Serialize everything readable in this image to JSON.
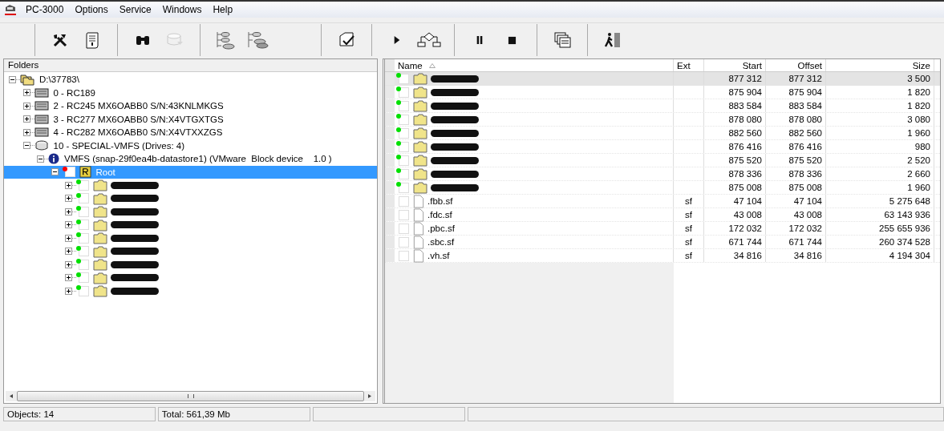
{
  "menu": [
    {
      "label": "PC-3000"
    },
    {
      "label": "Options"
    },
    {
      "label": "Service"
    },
    {
      "label": "Windows"
    },
    {
      "label": "Help"
    }
  ],
  "toolbar": [
    [
      {
        "kind": "tools",
        "disabled": false
      },
      {
        "kind": "scroll",
        "disabled": false
      }
    ],
    [
      {
        "kind": "binoculars",
        "disabled": false
      },
      {
        "kind": "disk",
        "disabled": true
      }
    ],
    [
      {
        "kind": "tree",
        "disabled": false
      },
      {
        "kind": "disks",
        "disabled": false
      }
    ],
    [
      {
        "kind": "document",
        "disabled": false
      }
    ],
    [
      {
        "kind": "play",
        "disabled": false
      },
      {
        "kind": "flowchart",
        "disabled": false
      }
    ],
    [
      {
        "kind": "pause",
        "disabled": false
      },
      {
        "kind": "stop",
        "disabled": false
      }
    ],
    [
      {
        "kind": "windows",
        "disabled": false
      }
    ],
    [
      {
        "kind": "exit",
        "disabled": false
      }
    ]
  ],
  "folders": {
    "title": "Folders",
    "tree": [
      {
        "label": "D:\\37783\\",
        "kind": "project",
        "expanded": true,
        "selected": false,
        "children": [
          {
            "label": "0 - RC189",
            "kind": "drive",
            "expanded": false,
            "selected": false
          },
          {
            "label": "2 - RC245 MX6OABB0 S/N:43KNLMKGS",
            "kind": "drive",
            "expanded": false,
            "selected": false
          },
          {
            "label": "3 - RC277 MX6OABB0 S/N:X4VTGXTGS",
            "kind": "drive",
            "expanded": false,
            "selected": false
          },
          {
            "label": "4 - RC282 MX6OABB0 S/N:X4VTXXZGS",
            "kind": "drive",
            "expanded": false,
            "selected": false
          },
          {
            "label": "10 - SPECIAL-VMFS (Drives: 4)",
            "kind": "array",
            "expanded": true,
            "selected": false,
            "children": [
              {
                "label": "VMFS (snap-29f0ea4b-datastore1) (VMware  Block device    1.0 )",
                "kind": "volume",
                "expanded": true,
                "selected": false,
                "children": [
                  {
                    "label": "Root",
                    "kind": "root",
                    "expanded": true,
                    "selected": true,
                    "checked": false,
                    "color": "#ff0000",
                    "children": [
                      {
                        "kind": "folder",
                        "expanded": false,
                        "selected": false,
                        "checked": false,
                        "color": "#00e000"
                      },
                      {
                        "kind": "folder",
                        "expanded": false,
                        "selected": false,
                        "checked": false,
                        "color": "#00e000"
                      },
                      {
                        "kind": "folder",
                        "expanded": false,
                        "selected": false,
                        "checked": false,
                        "color": "#00e000"
                      },
                      {
                        "kind": "folder",
                        "expanded": false,
                        "selected": false,
                        "checked": false,
                        "color": "#00e000"
                      },
                      {
                        "kind": "folder",
                        "expanded": false,
                        "selected": false,
                        "checked": false,
                        "color": "#00e000"
                      },
                      {
                        "kind": "folder",
                        "expanded": false,
                        "selected": false,
                        "checked": false,
                        "color": "#00e000"
                      },
                      {
                        "kind": "folder",
                        "expanded": false,
                        "selected": false,
                        "checked": false,
                        "color": "#00e000"
                      },
                      {
                        "kind": "folder",
                        "expanded": false,
                        "selected": false,
                        "checked": false,
                        "color": "#00e000"
                      },
                      {
                        "kind": "folder",
                        "expanded": false,
                        "selected": false,
                        "checked": false,
                        "color": "#00e000"
                      }
                    ]
                  }
                ]
              }
            ]
          }
        ]
      }
    ]
  },
  "files": {
    "columns": [
      {
        "label": "Name",
        "sorted": true
      },
      {
        "label": "Ext",
        "sorted": false
      },
      {
        "label": "Start",
        "sorted": false
      },
      {
        "label": "Offset",
        "sorted": false
      },
      {
        "label": "Size",
        "sorted": false
      }
    ],
    "rows": [
      {
        "kind": "folder",
        "selected": true,
        "checked": false,
        "color": "#00e000",
        "start": "877 312",
        "offset": "877 312",
        "size": "3 500"
      },
      {
        "kind": "folder",
        "selected": false,
        "checked": false,
        "color": "#00e000",
        "start": "875 904",
        "offset": "875 904",
        "size": "1 820"
      },
      {
        "kind": "folder",
        "selected": false,
        "checked": false,
        "color": "#00e000",
        "start": "883 584",
        "offset": "883 584",
        "size": "1 820"
      },
      {
        "kind": "folder",
        "selected": false,
        "checked": false,
        "color": "#00e000",
        "start": "878 080",
        "offset": "878 080",
        "size": "3 080"
      },
      {
        "kind": "folder",
        "selected": false,
        "checked": false,
        "color": "#00e000",
        "start": "882 560",
        "offset": "882 560",
        "size": "1 960"
      },
      {
        "kind": "folder",
        "selected": false,
        "checked": false,
        "color": "#00e000",
        "start": "876 416",
        "offset": "876 416",
        "size": "980"
      },
      {
        "kind": "folder",
        "selected": false,
        "checked": false,
        "color": "#00e000",
        "start": "875 520",
        "offset": "875 520",
        "size": "2 520"
      },
      {
        "kind": "folder",
        "selected": false,
        "checked": false,
        "color": "#00e000",
        "start": "878 336",
        "offset": "878 336",
        "size": "2 660"
      },
      {
        "kind": "folder",
        "selected": false,
        "checked": false,
        "color": "#00e000",
        "start": "875 008",
        "offset": "875 008",
        "size": "1 960"
      },
      {
        "kind": "file",
        "name": ".fbb.sf",
        "ext": "sf",
        "selected": false,
        "checked": false,
        "start": "47 104",
        "offset": "47 104",
        "size": "5 275 648"
      },
      {
        "kind": "file",
        "name": ".fdc.sf",
        "ext": "sf",
        "selected": false,
        "checked": false,
        "start": "43 008",
        "offset": "43 008",
        "size": "63 143 936"
      },
      {
        "kind": "file",
        "name": ".pbc.sf",
        "ext": "sf",
        "selected": false,
        "checked": false,
        "start": "172 032",
        "offset": "172 032",
        "size": "255 655 936"
      },
      {
        "kind": "file",
        "name": ".sbc.sf",
        "ext": "sf",
        "selected": false,
        "checked": false,
        "start": "671 744",
        "offset": "671 744",
        "size": "260 374 528"
      },
      {
        "kind": "file",
        "name": ".vh.sf",
        "ext": "sf",
        "selected": false,
        "checked": false,
        "start": "34 816",
        "offset": "34 816",
        "size": "4 194 304"
      }
    ]
  },
  "status_bar": [
    "Objects: 14",
    "Total: 561,39 Mb"
  ]
}
